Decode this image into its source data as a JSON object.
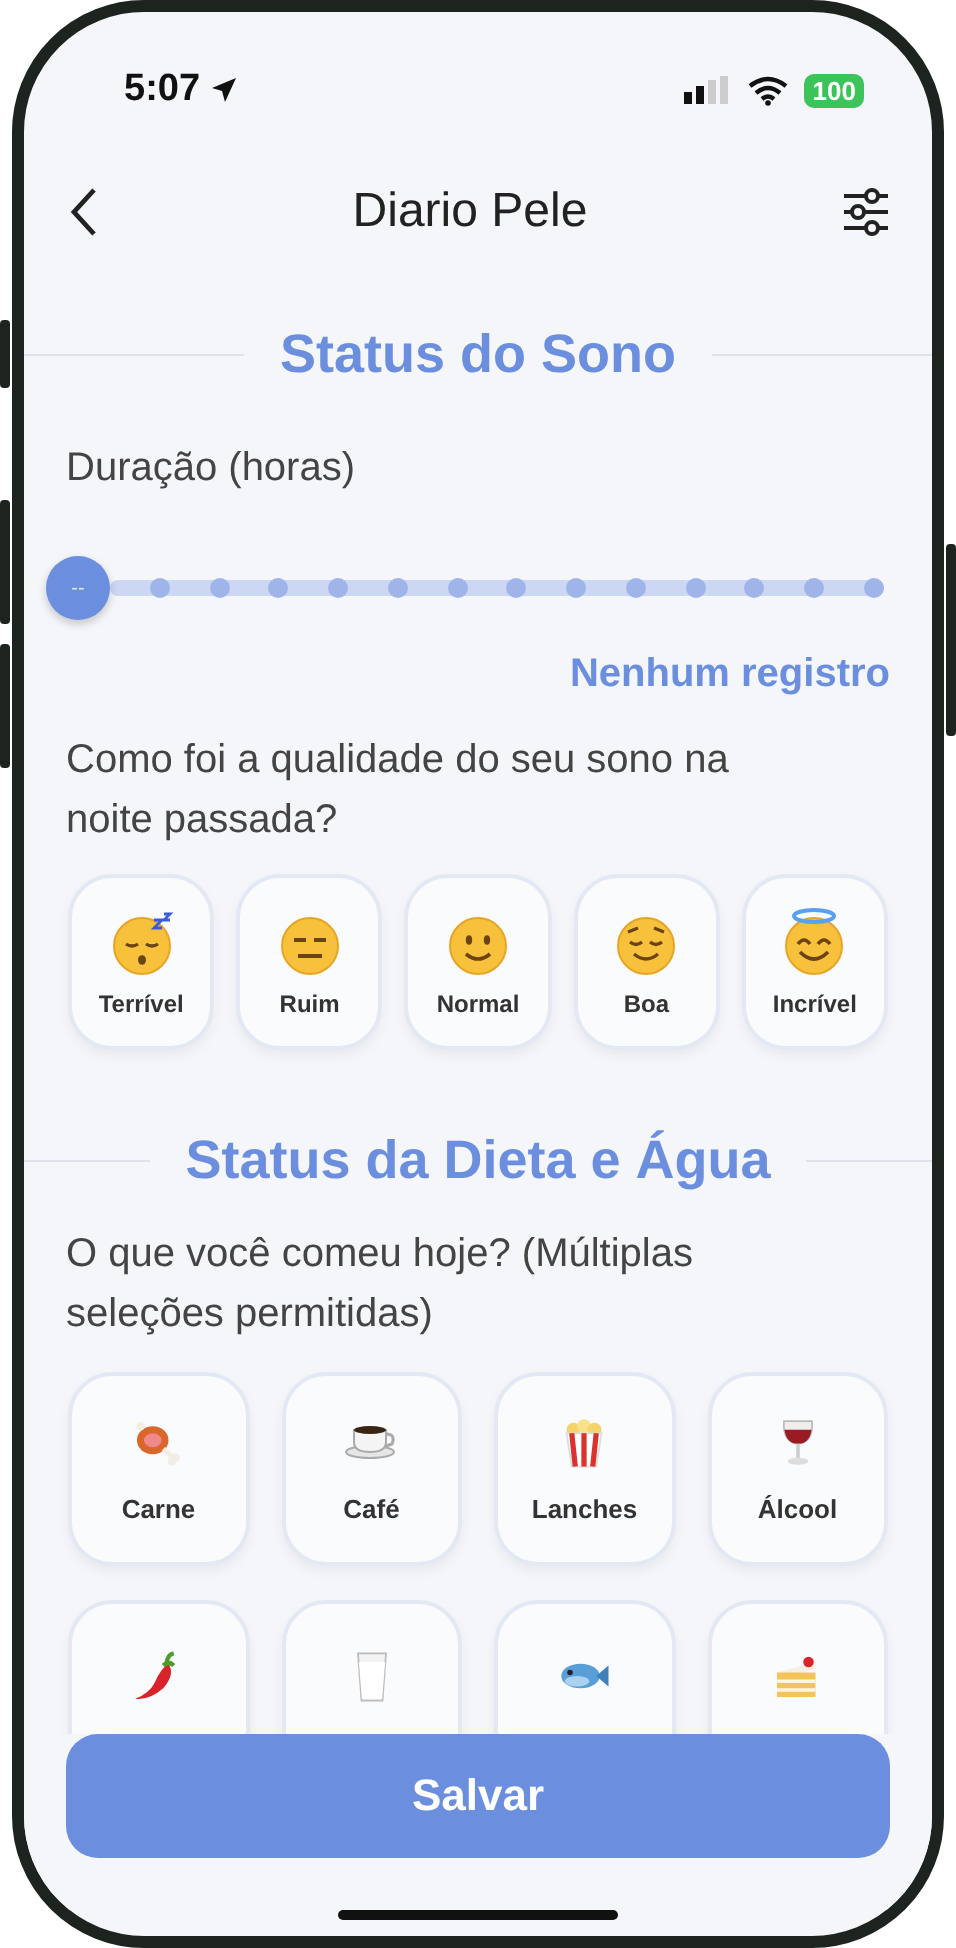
{
  "status_bar": {
    "time": "5:07",
    "battery": "100"
  },
  "header": {
    "title": "Diario Pele"
  },
  "sleep": {
    "title": "Status do Sono",
    "duration_label": "Duração (horas)",
    "slider": {
      "thumb_text": "--",
      "level": 0
    },
    "reading": "Nenhum registro",
    "question": "Como foi a qualidade do seu sono na noite passada?",
    "options": [
      {
        "label": "Terrível",
        "selected": false
      },
      {
        "label": "Ruim",
        "selected": false
      },
      {
        "label": "Normal",
        "selected": false
      },
      {
        "label": "Boa",
        "selected": false
      },
      {
        "label": "Incrível",
        "selected": false
      }
    ]
  },
  "diet": {
    "title": "Status da Dieta e Água",
    "question": "O que você comeu hoje? (Múltiplas seleções permitidas)",
    "foods": [
      {
        "label": "Carne",
        "selected": false
      },
      {
        "label": "Café",
        "selected": false
      },
      {
        "label": "Lanches",
        "selected": false
      },
      {
        "label": "Álcool",
        "selected": false
      },
      {
        "selected": false
      },
      {
        "selected": false
      },
      {
        "selected": false
      },
      {
        "selected": false
      }
    ]
  },
  "save_button": "Salvar"
}
